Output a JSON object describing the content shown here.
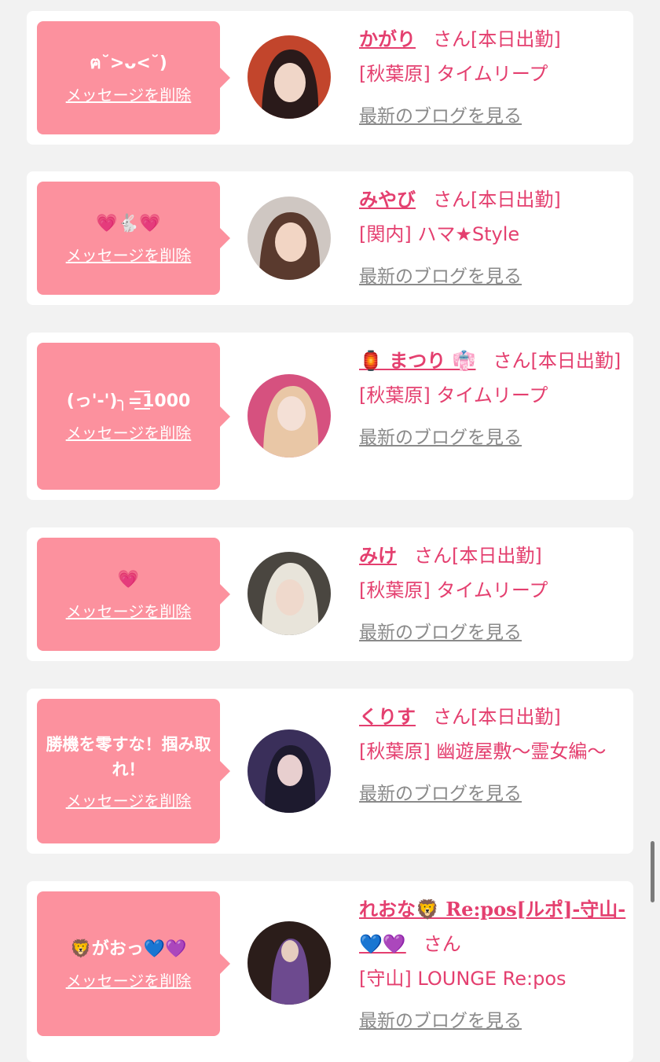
{
  "delete_label": "メッセージを削除",
  "blog_label": "最新のブログを見る",
  "san": "さん",
  "cards": [
    {
      "message": "ฅ˘>ᴗ<˘)",
      "name": "かがり",
      "status": "[本日出勤]",
      "shop": "[秋葉原] タイムリープ",
      "avatar_colors": [
        "#c2452c",
        "#2a1a1a",
        "#f0d6c8"
      ]
    },
    {
      "message": "💗🐇💗",
      "name": "みやび",
      "status": "[本日出勤]",
      "shop": "[関内] ハマ★Style",
      "avatar_colors": [
        "#cfc7c2",
        "#5a3a2e",
        "#f2d5c4"
      ]
    },
    {
      "message": "(っ'-')╮=͟͟͞͞1000",
      "name": "🏮 まつり 👘",
      "status": "[本日出勤]",
      "shop": "[秋葉原] タイムリープ",
      "avatar_colors": [
        "#d6517f",
        "#e9c7a6",
        "#f4e0d6"
      ]
    },
    {
      "message": "💗",
      "name": "みけ",
      "status": "[本日出勤]",
      "shop": "[秋葉原] タイムリープ",
      "avatar_colors": [
        "#4a4640",
        "#e8e4da",
        "#efd9cc"
      ]
    },
    {
      "message": "勝機を零すな！掴み取れ！",
      "name": "くりす",
      "status": "[本日出勤]",
      "shop": "[秋葉原] 幽遊屋敷〜霊女編〜",
      "avatar_colors": [
        "#3a2f5a",
        "#1d1a2e",
        "#e8cfcf"
      ]
    },
    {
      "message": "🦁がおっ💙💜",
      "name": "れおな🦁 Re:pos[ルポ]-守山-💙💜",
      "status": "",
      "shop": "[守山] LOUNGE Re:pos",
      "avatar_colors": [
        "#2b1d1a",
        "#6d4a8f",
        "#e6cdbf"
      ]
    }
  ]
}
